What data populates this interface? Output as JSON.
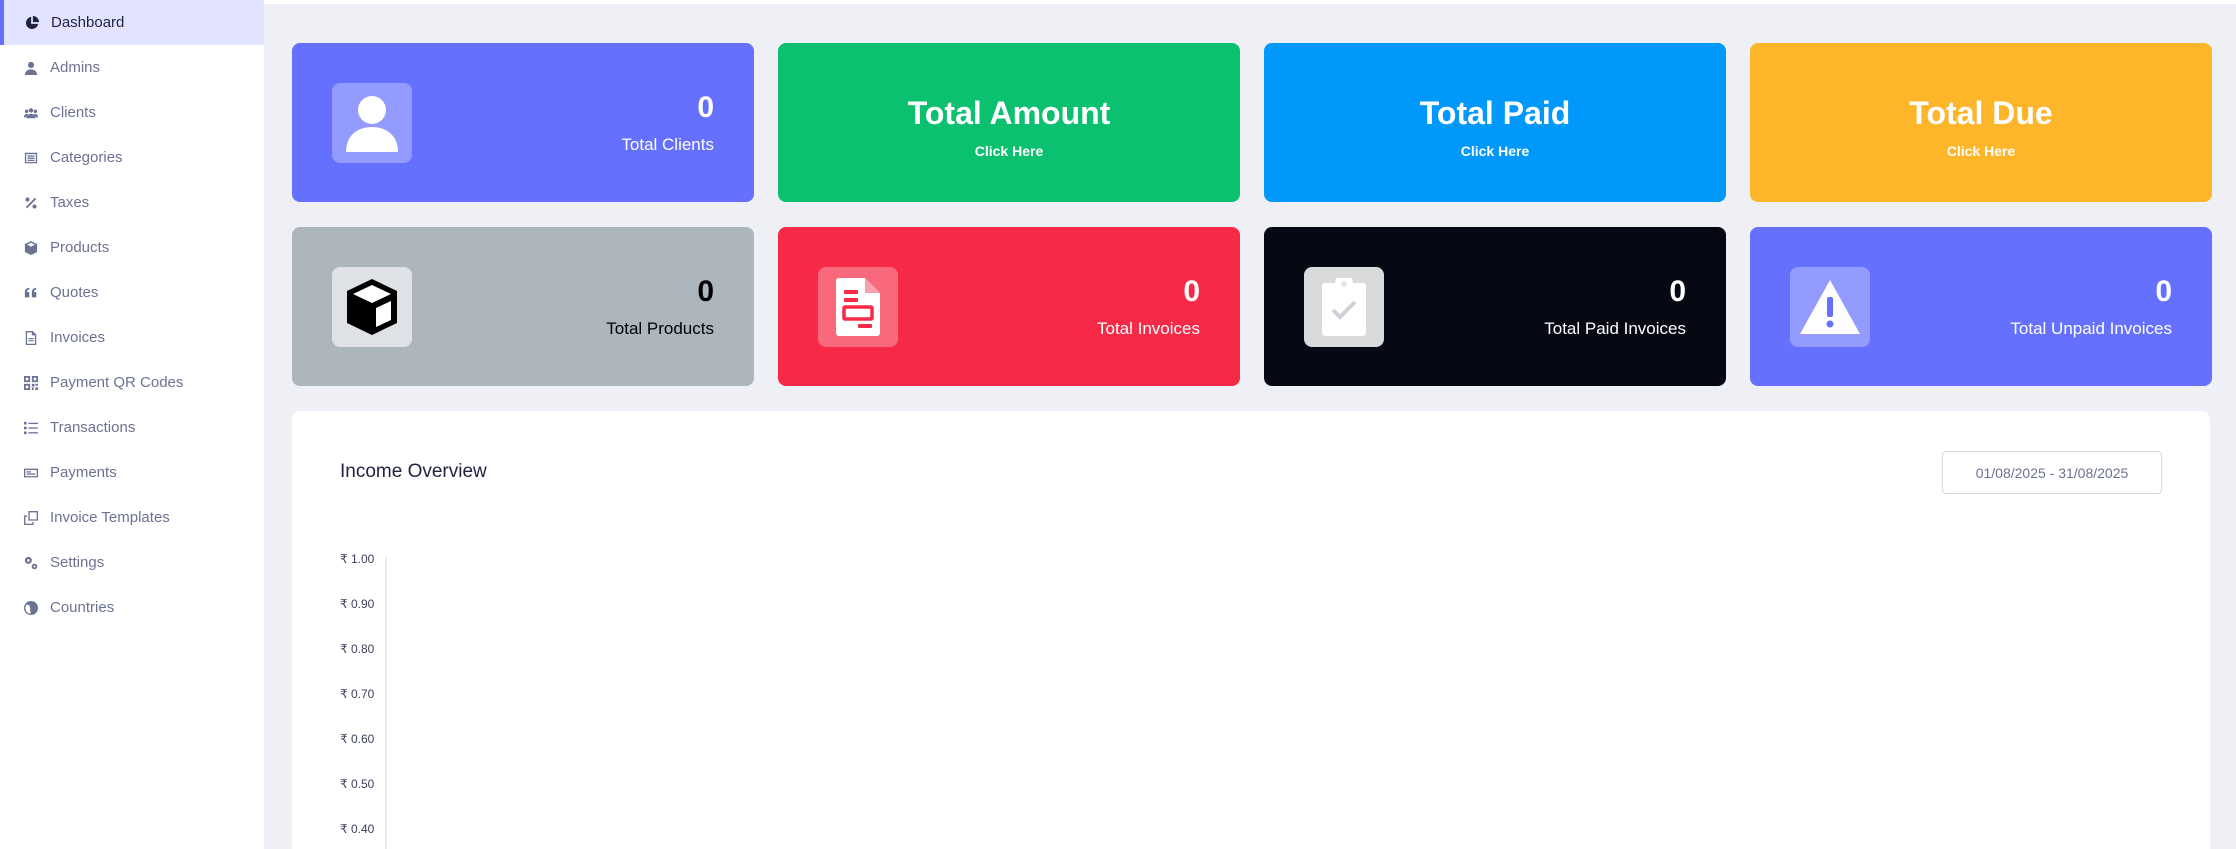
{
  "sidebar": {
    "items": [
      {
        "label": "Dashboard",
        "icon": "chart-pie-icon",
        "active": true
      },
      {
        "label": "Admins",
        "icon": "user-icon"
      },
      {
        "label": "Clients",
        "icon": "users-icon"
      },
      {
        "label": "Categories",
        "icon": "list-alt-icon"
      },
      {
        "label": "Taxes",
        "icon": "percent-icon"
      },
      {
        "label": "Products",
        "icon": "cubes-icon"
      },
      {
        "label": "Quotes",
        "icon": "quote-icon"
      },
      {
        "label": "Invoices",
        "icon": "file-icon"
      },
      {
        "label": "Payment QR Codes",
        "icon": "qr-code-icon"
      },
      {
        "label": "Transactions",
        "icon": "list-ol-icon"
      },
      {
        "label": "Payments",
        "icon": "money-check-icon"
      },
      {
        "label": "Invoice Templates",
        "icon": "copy-icon"
      },
      {
        "label": "Settings",
        "icon": "cogs-icon"
      },
      {
        "label": "Countries",
        "icon": "globe-icon"
      }
    ]
  },
  "cards": {
    "clients": {
      "value": "0",
      "label": "Total Clients",
      "color": "#6570ff"
    },
    "amount": {
      "title": "Total Amount",
      "link": "Click Here",
      "color": "#0bc170"
    },
    "paid": {
      "title": "Total Paid",
      "link": "Click Here",
      "color": "#0098fa"
    },
    "due": {
      "title": "Total Due",
      "link": "Click Here",
      "color": "#fdb62a"
    },
    "products": {
      "value": "0",
      "label": "Total Products",
      "color": "#adb5bd"
    },
    "invoices": {
      "value": "0",
      "label": "Total Invoices",
      "color": "#f62947"
    },
    "paid_invoices": {
      "value": "0",
      "label": "Total Paid Invoices",
      "color": "#050914"
    },
    "unpaid_invoices": {
      "value": "0",
      "label": "Total Unpaid Invoices",
      "color": "#6570ff"
    }
  },
  "income": {
    "title": "Income Overview",
    "date_range": "01/08/2025 - 31/08/2025"
  },
  "chart_data": {
    "type": "line",
    "title": "",
    "xlabel": "",
    "ylabel": "",
    "y_ticks": [
      "₹ 1.00",
      "₹ 0.90",
      "₹ 0.80",
      "₹ 0.70",
      "₹ 0.60",
      "₹ 0.50",
      "₹ 0.40"
    ],
    "y_tick_values": [
      1.0,
      0.9,
      0.8,
      0.7,
      0.6,
      0.5,
      0.4
    ],
    "series": []
  }
}
